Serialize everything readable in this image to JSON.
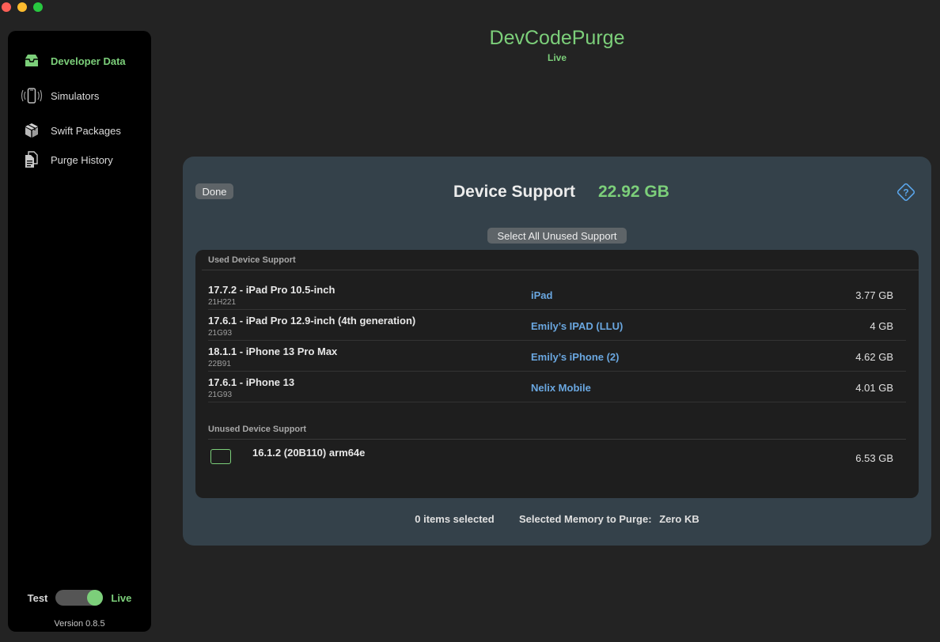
{
  "app": {
    "title": "DevCodePurge",
    "mode": "Live"
  },
  "sidebar": {
    "items": [
      {
        "label": "Developer Data",
        "icon": "tray-icon"
      },
      {
        "label": "Simulators",
        "icon": "phone-vibrate-icon"
      },
      {
        "label": "Swift Packages",
        "icon": "package-icon"
      },
      {
        "label": "Purge History",
        "icon": "documents-icon"
      }
    ],
    "toggle": {
      "left_label": "Test",
      "right_label": "Live",
      "on": true
    },
    "version": "Version 0.8.5"
  },
  "panel": {
    "done_label": "Done",
    "title": "Device Support",
    "total_size": "22.92 GB",
    "help_icon": "question-diamond-icon",
    "select_unused_label": "Select All Unused Support",
    "used_header": "Used Device Support",
    "used_rows": [
      {
        "name": "17.7.2 - iPad Pro 10.5-inch",
        "build": "21H221",
        "device": "iPad",
        "size": "3.77 GB"
      },
      {
        "name": "17.6.1 - iPad Pro 12.9-inch (4th generation)",
        "build": "21G93",
        "device": "Emily’s IPAD (LLU)",
        "size": "4 GB"
      },
      {
        "name": "18.1.1 - iPhone 13 Pro Max",
        "build": "22B91",
        "device": "Emily’s iPhone (2)",
        "size": "4.62 GB"
      },
      {
        "name": "17.6.1 - iPhone 13",
        "build": "21G93",
        "device": "Nelix Mobile",
        "size": "4.01 GB"
      }
    ],
    "unused_header": "Unused Device Support",
    "unused_rows": [
      {
        "name": "16.1.2 (20B110) arm64e",
        "size": "6.53 GB",
        "checked": false
      }
    ],
    "footer": {
      "items_selected": "0 items selected",
      "memory_label": "Selected Memory to Purge:",
      "memory_value": "Zero KB"
    }
  },
  "colors": {
    "accent": "#7ccf7a",
    "link": "#6aa7e0",
    "panel": "#34414a"
  }
}
